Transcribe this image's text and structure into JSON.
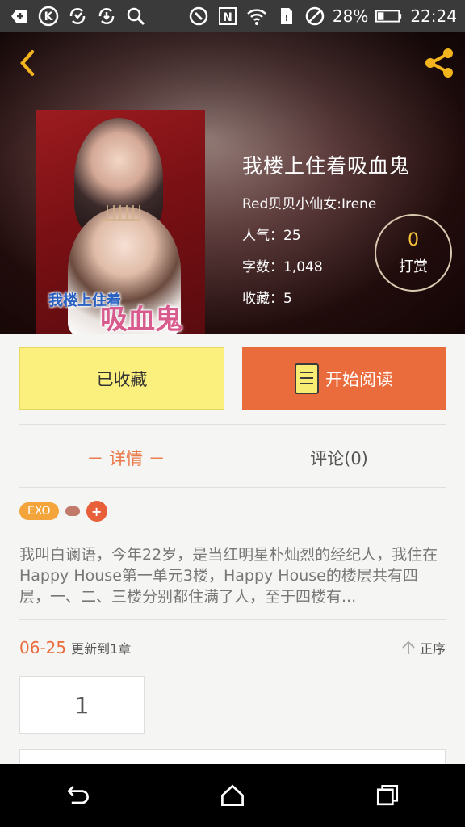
{
  "status_bar": {
    "battery": "28%",
    "time": "22:24"
  },
  "book": {
    "title": "我楼上住着吸血鬼",
    "author": "Red贝贝小仙女:Irene",
    "popularity": "人气：25",
    "word_count": "字数：1,048",
    "favorites": "收藏：5",
    "cover_text_small": "我楼上住着",
    "cover_text_big": "吸血鬼"
  },
  "reward": {
    "count": "0",
    "label": "打赏"
  },
  "actions": {
    "collected_label": "已收藏",
    "read_label": "开始阅读"
  },
  "tabs": {
    "details": "－ 详情 －",
    "comments": "评论(0)"
  },
  "tags": {
    "exo": "EXO",
    "add": "+"
  },
  "summary": "我叫白谰语，今年22岁，是当红明星朴灿烈的经纪人，我住在Happy House第一单元3楼，Happy House的楼层共有四层，一、二、三楼分别都住满了人，至于四楼有...",
  "update": {
    "date": "06-25",
    "text": "更新到1章",
    "sort_label": "正序"
  },
  "chapters": {
    "first": "1"
  },
  "colors": {
    "accent_orange": "#ea6c3c",
    "collect_yellow": "#fbf07e",
    "reward_gold": "#f6c33a"
  }
}
